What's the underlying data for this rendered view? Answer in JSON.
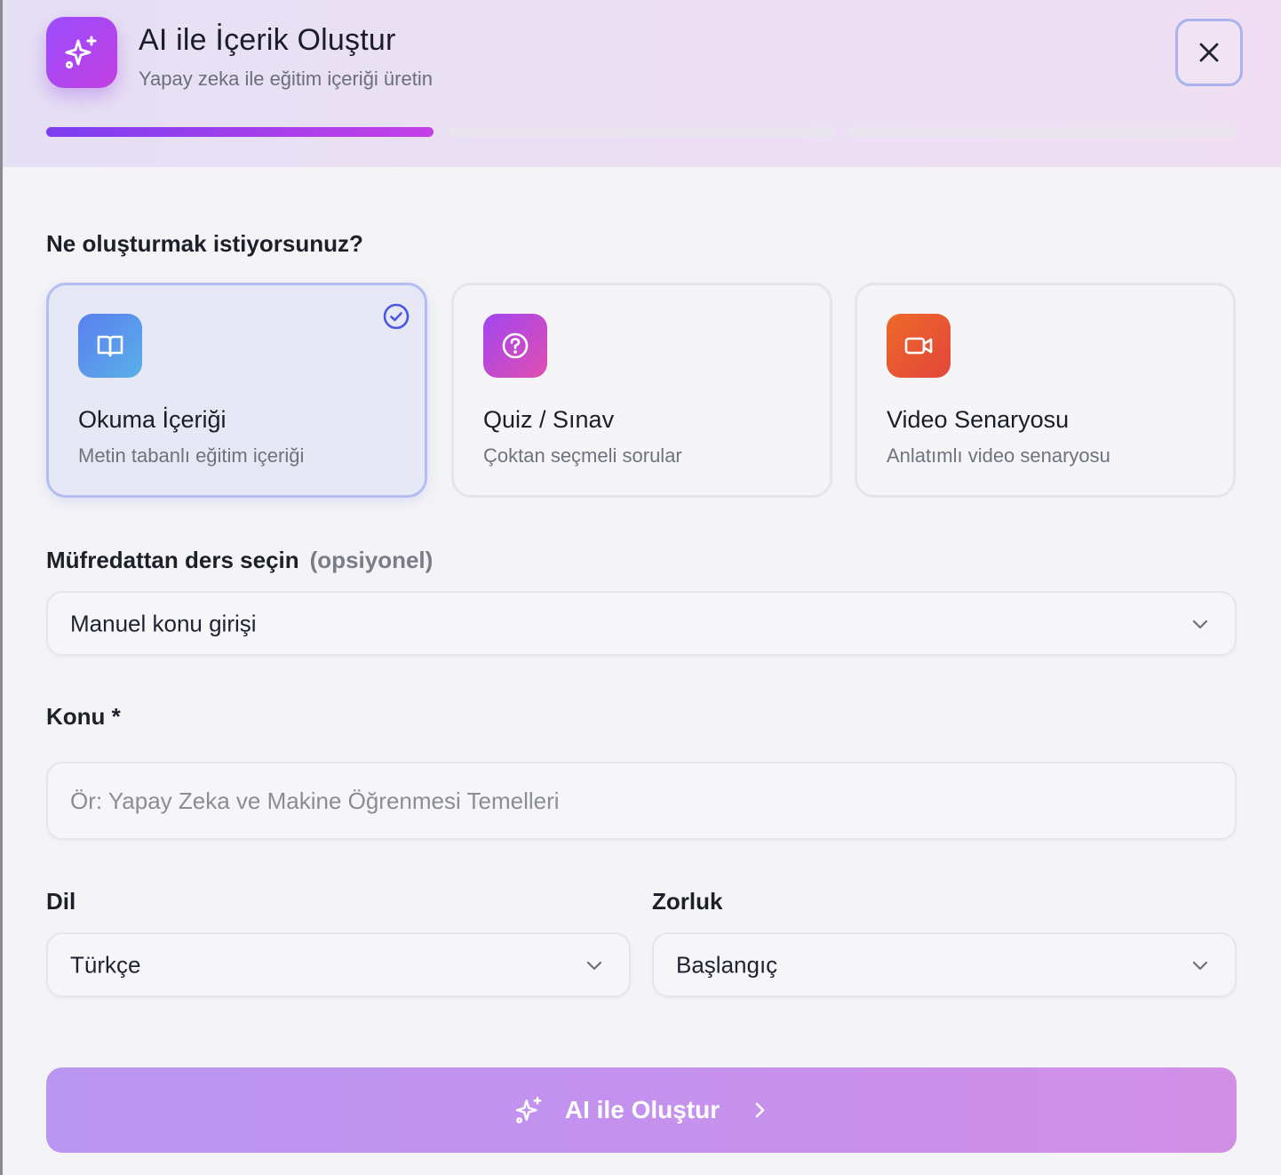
{
  "header": {
    "title": "AI ile İçerik Oluştur",
    "subtitle": "Yapay zeka ile eğitim içeriği üretin",
    "logo_icon": "sparkles-icon",
    "close_icon": "close-icon",
    "steps_total": 3,
    "current_step": 1
  },
  "content_type": {
    "question": "Ne oluşturmak istiyorsunuz?",
    "selected": "reading",
    "options": [
      {
        "id": "reading",
        "title": "Okuma İçeriği",
        "description": "Metin tabanlı eğitim içeriği",
        "icon": "book-icon",
        "color": "#5a8cf0"
      },
      {
        "id": "quiz",
        "title": "Quiz / Sınav",
        "description": "Çoktan seçmeli sorular",
        "icon": "question-circle-icon",
        "color": "#c24bd6"
      },
      {
        "id": "video",
        "title": "Video Senaryosu",
        "description": "Anlatımlı video senaryosu",
        "icon": "video-camera-icon",
        "color": "#e8582e"
      }
    ]
  },
  "curriculum": {
    "label": "Müfredattan ders seçin",
    "optional": "(opsiyonel)",
    "value": "Manuel konu girişi"
  },
  "topic": {
    "label": "Konu *",
    "placeholder": "Ör: Yapay Zeka ve Makine Öğrenmesi Temelleri",
    "value": ""
  },
  "language": {
    "label": "Dil",
    "value": "Türkçe"
  },
  "difficulty": {
    "label": "Zorluk",
    "value": "Başlangıç"
  },
  "submit": {
    "label": "AI ile Oluştur"
  },
  "colors": {
    "accent": "#7b3ff0",
    "accent_end": "#c43fe6",
    "selected_border": "#b3bdf2"
  }
}
